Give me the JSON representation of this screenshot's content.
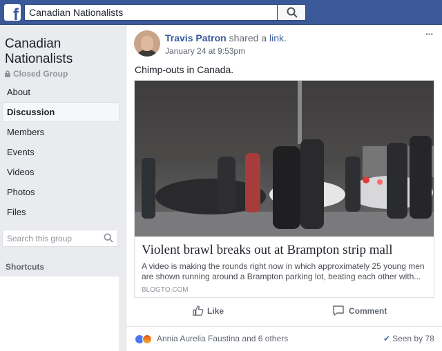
{
  "topbar": {
    "logo_letter": "f",
    "search_value": "Canadian Nationalists"
  },
  "sidebar": {
    "group_name": "Canadian Nationalists",
    "group_type": "Closed Group",
    "nav": [
      {
        "label": "About"
      },
      {
        "label": "Discussion"
      },
      {
        "label": "Members"
      },
      {
        "label": "Events"
      },
      {
        "label": "Videos"
      },
      {
        "label": "Photos"
      },
      {
        "label": "Files"
      }
    ],
    "search_placeholder": "Search this group",
    "shortcuts_title": "Shortcuts"
  },
  "post": {
    "author": "Travis Patron",
    "shared_text": "shared a",
    "link_word": "link",
    "timestamp": "January 24 at 9:53pm",
    "more": "···",
    "text": "Chimp-outs in Canada.",
    "link_card": {
      "title": "Violent brawl breaks out at Brampton strip mall",
      "description": "A video is making the rounds right now in which approximately 25 young men are shown running around a Brampton parking lot, beating each other with...",
      "domain": "BLOGTO.COM"
    },
    "actions": {
      "like": "Like",
      "comment": "Comment"
    },
    "footer": {
      "reacted_names": "Annia Aurelia Faustina and 6 others",
      "seen": "Seen by 78"
    }
  },
  "colors": {
    "brand": "#3b5998",
    "link": "#365899",
    "secondary_text": "#616770"
  }
}
